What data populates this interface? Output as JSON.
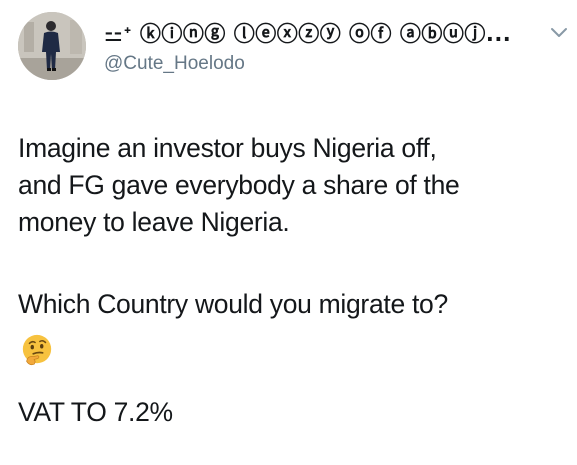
{
  "tweet": {
    "author": {
      "display_name": "⚍ᐩ ⓚⓘⓝⓖ ⓛⓔⓧⓩⓨ ⓞⓕ ⓐⓑⓤⓙ...",
      "handle": "@Cute_Hoelodo",
      "avatar_icon": "user-avatar-photo"
    },
    "menu_icon": "chevron-down-icon",
    "text": {
      "lines": [
        "Imagine an investor buys Nigeria off,",
        "and FG gave everybody a share of the",
        "money to leave Nigeria."
      ],
      "question": "Which Country would you migrate to?",
      "emoji": "thinking-face-emoji",
      "footer": "VAT TO 7.2%"
    },
    "colors": {
      "text": "#14171a",
      "secondary": "#657786",
      "chevron": "#8899a6",
      "emoji_face": "#f7c23f"
    }
  }
}
